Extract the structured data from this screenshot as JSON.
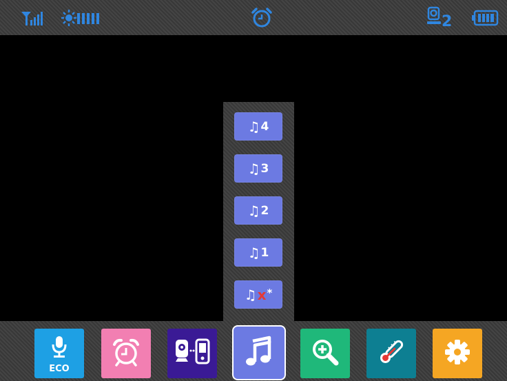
{
  "status_bar": {
    "signal_icon": "signal-bars-icon",
    "brightness_icon": "brightness-level-icon",
    "alarm_icon": "alarm-clock-icon",
    "camera_icon": "camera-icon",
    "camera_number": "2",
    "battery_icon": "battery-full-icon",
    "accent_color": "#2f86e0"
  },
  "music_menu": {
    "items": [
      {
        "number": "4",
        "icon": "music-note-icon"
      },
      {
        "number": "3",
        "icon": "music-note-icon"
      },
      {
        "number": "2",
        "icon": "music-note-icon"
      },
      {
        "number": "1",
        "icon": "music-note-icon"
      },
      {
        "number": "",
        "off_mark": "x",
        "star": "*",
        "icon": "music-note-icon"
      }
    ],
    "note_glyph": "♫",
    "button_color": "#6c7ae2"
  },
  "toolbar": {
    "items": [
      {
        "name": "eco-mic",
        "label": "ECO",
        "icon": "microphone-icon",
        "color": "#1ea0e4"
      },
      {
        "name": "alarm",
        "icon": "alarm-clock-icon",
        "color": "#f27fb2"
      },
      {
        "name": "camera-pair",
        "icon": "camera-monitor-icon",
        "color": "#3a1a95"
      },
      {
        "name": "music",
        "icon": "music-note-icon",
        "color": "#6c7ae2",
        "selected": true
      },
      {
        "name": "zoom",
        "icon": "zoom-in-icon",
        "color": "#1fb87a"
      },
      {
        "name": "temperature",
        "icon": "thermometer-icon",
        "color": "#0d7f92"
      },
      {
        "name": "settings",
        "icon": "gear-icon",
        "color": "#f5a623"
      }
    ]
  }
}
